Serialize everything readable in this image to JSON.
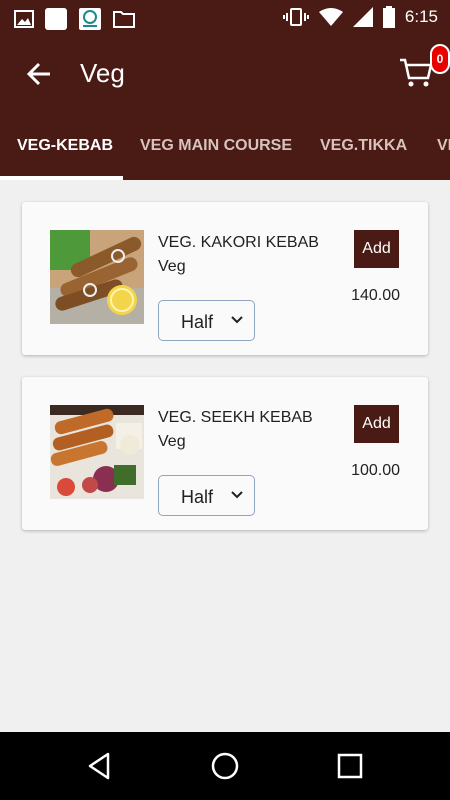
{
  "status_bar": {
    "time": "6:15"
  },
  "app_bar": {
    "title": "Veg",
    "cart_count": "0"
  },
  "tabs": [
    {
      "label": "VEG-KEBAB"
    },
    {
      "label": "VEG MAIN COURSE"
    },
    {
      "label": "VEG.TIKKA"
    },
    {
      "label": "VE"
    }
  ],
  "items": [
    {
      "name": "VEG. KAKORI KEBAB",
      "category": "Veg",
      "add_label": "Add",
      "price": "140.00",
      "portion": "Half"
    },
    {
      "name": "VEG. SEEKH KEBAB",
      "category": "Veg",
      "add_label": "Add",
      "price": "100.00",
      "portion": "Half"
    }
  ],
  "colors": {
    "primary": "#4a1a14",
    "badge": "#e60000",
    "background": "#f0f0f0",
    "select_border": "#8ea5c4"
  }
}
